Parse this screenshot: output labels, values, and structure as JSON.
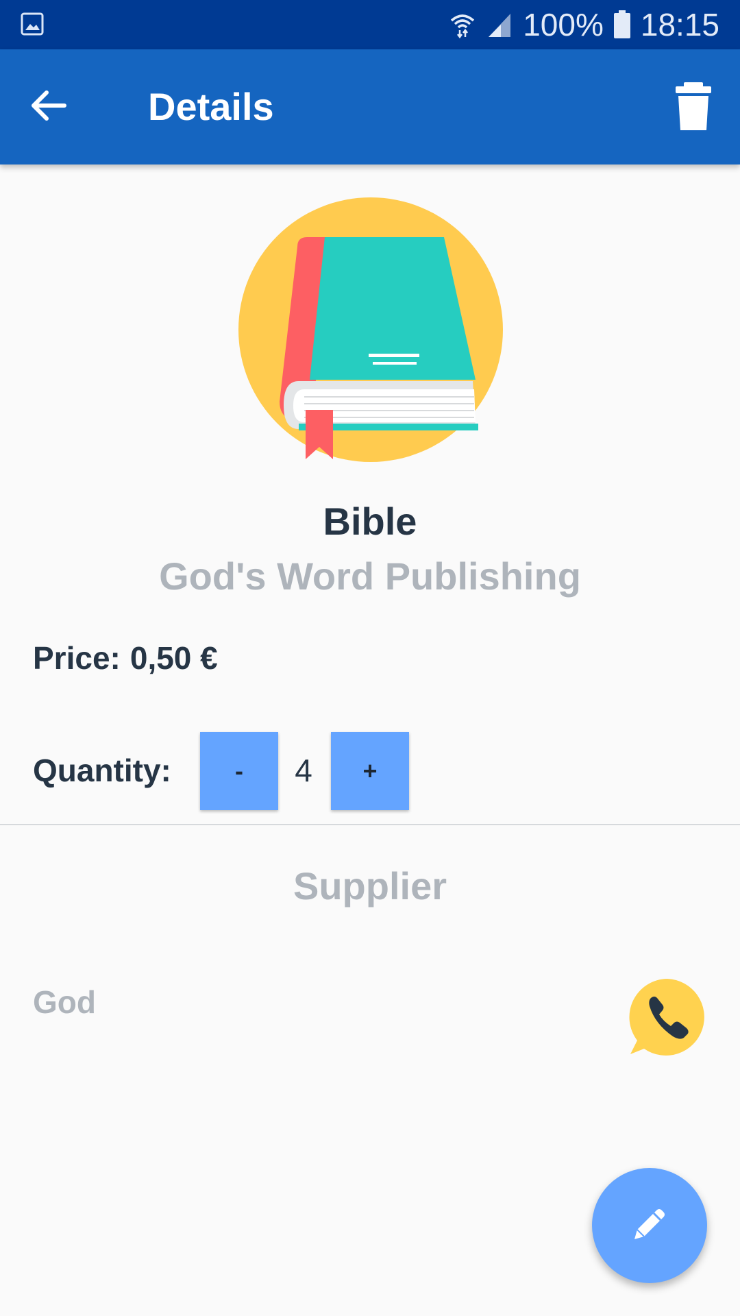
{
  "status_bar": {
    "battery": "100%",
    "time": "18:15"
  },
  "app_bar": {
    "title": "Details"
  },
  "product": {
    "name": "Bible",
    "publisher": "God's Word Publishing",
    "price_label": "Price:",
    "price_value": "0,50 €",
    "quantity_label": "Quantity:",
    "quantity_value": "4",
    "decrement_label": "-",
    "increment_label": "+"
  },
  "supplier": {
    "heading": "Supplier",
    "name": "God"
  },
  "icons": {
    "status_left": "gallery-icon",
    "wifi": "wifi-icon",
    "signal": "signal-icon",
    "battery": "battery-icon",
    "back": "arrow-back-icon",
    "delete": "trash-icon",
    "product": "book-icon",
    "call": "phone-icon",
    "edit": "pencil-icon"
  },
  "colors": {
    "status_bar": "#003a93",
    "app_bar": "#1565c0",
    "accent_button": "#64a4ff",
    "text_primary": "#263545",
    "text_muted": "#aeb4bb",
    "book_cover": "#26cdc0",
    "book_spine": "#fd5f63",
    "circle_bg": "#ffcb4f"
  }
}
